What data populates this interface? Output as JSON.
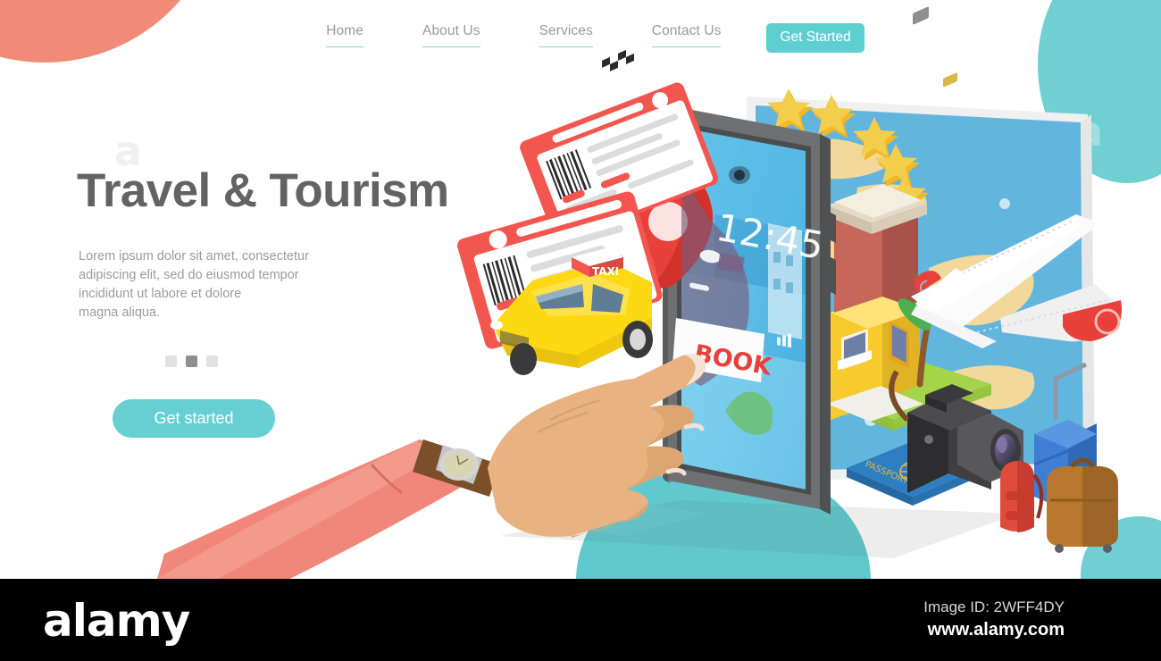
{
  "page": {
    "type": "landing-page-hero-illustration",
    "background": "#ffffff"
  },
  "colors": {
    "accent_teal": "#5ECFD1",
    "accent_coral": "#F08B77",
    "heading_gray": "#636363",
    "body_gray": "#9b9b9b",
    "nav_gray": "#9a9a9a",
    "nav_underline": "#8fd5d2",
    "dot_inactive": "#e2e2e2",
    "dot_active": "#8e8e8e",
    "watermark_bar": "#000000"
  },
  "nav": {
    "items": [
      {
        "label": "Home",
        "underline": true
      },
      {
        "label": "About Us",
        "underline": true
      },
      {
        "label": "Services",
        "underline": true
      },
      {
        "label": "Contact Us",
        "underline": true
      }
    ],
    "cta_label": "Get Started"
  },
  "hero": {
    "headline": "Travel & Tourism",
    "body": "Lorem ipsum dolor sit amet, consectetur\nadipiscing elit, sed do eiusmod tempor\nincididunt ut labore et dolore\nmagna aliqua.",
    "dots": [
      {
        "active": false
      },
      {
        "active": true
      },
      {
        "active": false
      }
    ],
    "cta_label": "Get started"
  },
  "illustration": {
    "description": "Isometric travel booking scene: a hand reaching toward a smartphone surrounded by travel objects",
    "phone": {
      "status_time": "12:45",
      "book_button_label": "BOOK",
      "book_button_color": "#E8403A",
      "screen_bg": "#5EC3E8"
    },
    "objects": [
      {
        "name": "boarding-pass-ticket",
        "count": 2,
        "color": "#F2564E"
      },
      {
        "name": "taxi-cab",
        "label": "TAXI",
        "color": "#FCD913"
      },
      {
        "name": "map-location-pin",
        "color": "#E8403A"
      },
      {
        "name": "hotel-building",
        "colors": [
          "#C7675C",
          "#F7CB2E"
        ]
      },
      {
        "name": "five-star-rating",
        "stars": 5,
        "color": "#F5B722"
      },
      {
        "name": "world-map-poster",
        "colors": [
          "#62B6DE",
          "#F3D89B"
        ]
      },
      {
        "name": "airplane",
        "color": "#FFFFFF"
      },
      {
        "name": "passport",
        "label": "PASSPORT",
        "color": "#2E7FC2"
      },
      {
        "name": "dslr-camera",
        "color": "#3A3A3C"
      },
      {
        "name": "suitcase-blue",
        "color": "#3E7FD4"
      },
      {
        "name": "backpack-red",
        "color": "#E04B3C"
      },
      {
        "name": "suitcase-brown",
        "color": "#B8792F"
      },
      {
        "name": "palm-tree",
        "color": "#4CAF50"
      },
      {
        "name": "wristwatch",
        "color": "#7A4F2A"
      },
      {
        "name": "hand-and-arm",
        "sleeve_color": "#F0877A"
      }
    ]
  },
  "watermark": {
    "logo": "alamy",
    "image_id_label": "Image ID: 2WFF4DY",
    "url": "www.alamy.com",
    "ghost_letter": "a"
  }
}
